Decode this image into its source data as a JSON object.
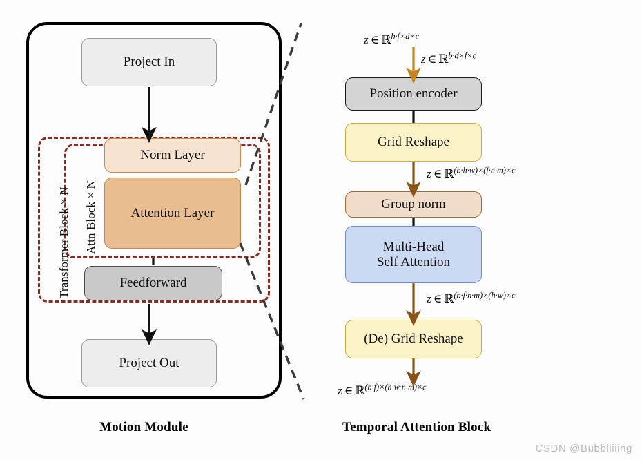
{
  "diagram": {
    "title": "Motion Module and Temporal Attention Block",
    "watermark": "CSDN @Bubbliiiing"
  },
  "colors": {
    "panel_border": "#000000",
    "dashed_red": "#8c2a20",
    "connector_dash": "#3a3a3a",
    "arrow_black": "#111111",
    "arrow_amber": "#c8851f",
    "arrow_brown": "#8a5418",
    "gray_fill": "#ededed",
    "gray_border": "#9a9a9a",
    "midgray_fill": "#c9c9c9",
    "midgray_border": "#4a4a4a",
    "tan_light_fill": "#f5e3d0",
    "tan_light_border": "#c98a4b",
    "tan_deep_fill": "#e8bd90",
    "tan_deep_border": "#c9864a",
    "posenc_fill": "#d4d4d4",
    "posenc_border": "#1a1a1a",
    "yellow_fill": "#fbf2c8",
    "yellow_border": "#c8ae3e",
    "peach_fill": "#f1dbc9",
    "peach_border": "#a3682f",
    "blue_fill": "#ccd9f2",
    "blue_border": "#6f8fd0"
  },
  "left_panel": {
    "caption": "Motion Module",
    "nodes": {
      "project_in": "Project In",
      "norm_layer": "Norm Layer",
      "attention_layer": "Attention Layer",
      "feedforward": "Feedforward",
      "project_out": "Project Out"
    },
    "group_labels": {
      "transformer_block": "Transformer Block × N",
      "attn_block": "Attn Block × N"
    }
  },
  "right_panel": {
    "caption": "Temporal Attention Block",
    "nodes": {
      "position_encoder": "Position encoder",
      "grid_reshape": "Grid Reshape",
      "group_norm": "Group norm",
      "mhsa_line1": "Multi-Head",
      "mhsa_line2": "Self Attention",
      "de_grid_reshape": "(De) Grid Reshape"
    },
    "annotations": {
      "input_shape": "z ∈ ℝ",
      "a1_sup": "b·f×d×c",
      "a2_sup": "b·d×f×c",
      "a3_sup": "(b·h·w)×(f·n·m)×c",
      "a4_sup": "(b·f·n·m)×(h·w)×c",
      "a5_sup": "(b·f)×(h·w·n·m)×c",
      "z_symbol": "z",
      "in_symbol": "∈",
      "reals_symbol": "ℝ"
    }
  }
}
